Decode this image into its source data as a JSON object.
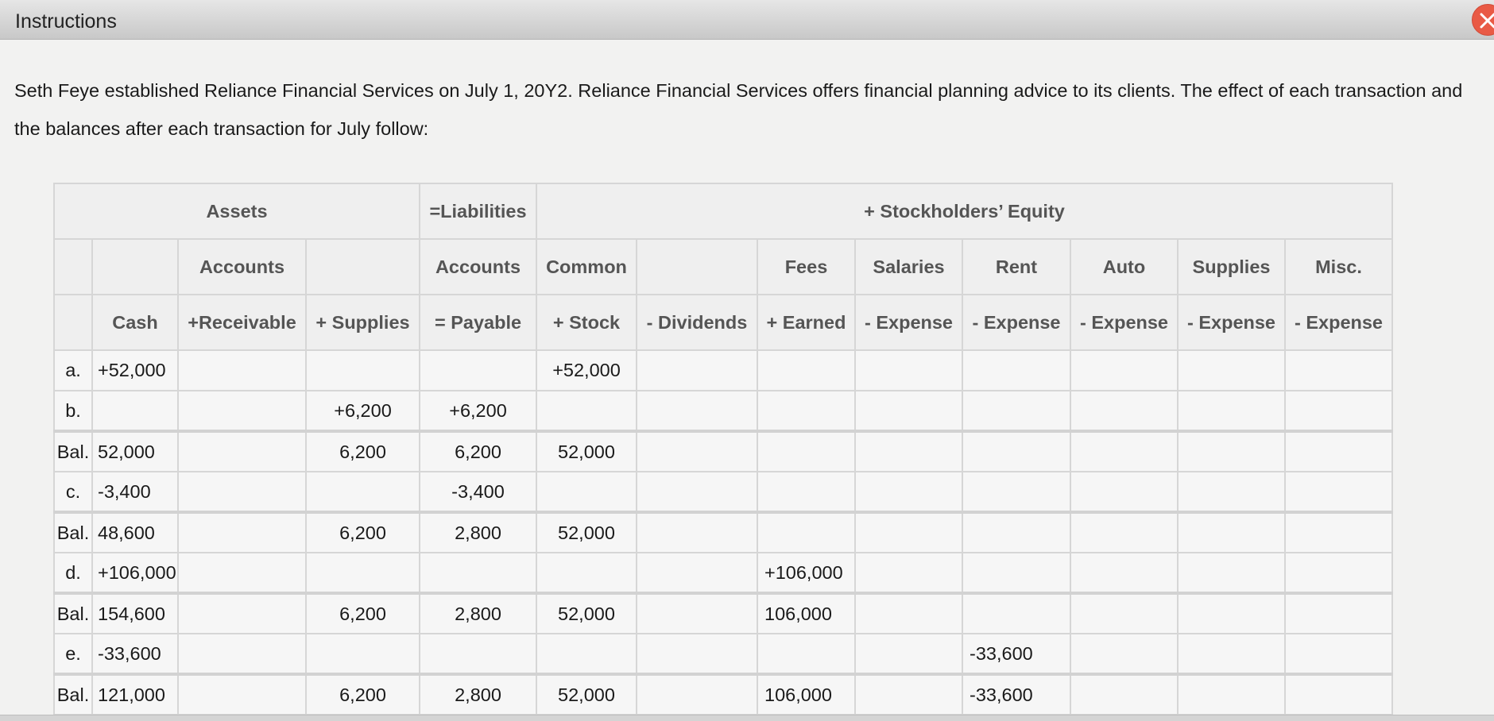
{
  "window": {
    "title": "Instructions",
    "close_label": "X"
  },
  "intro": {
    "line1": "Seth Feye established Reliance Financial Services on July 1, 20Y2. Reliance Financial Services offers financial planning advice to its clients. The effect of each transaction and",
    "line2": "the balances after each transaction for July follow:"
  },
  "table": {
    "group_headers": {
      "assets": "Assets",
      "liabilities": "=Liabilities",
      "equity": "+ Stockholders’ Equity"
    },
    "header_row1": [
      "",
      "",
      "Accounts",
      "",
      "Accounts",
      "Common",
      "",
      "Fees",
      "Salaries",
      "Rent",
      "Auto",
      "Supplies",
      "Misc."
    ],
    "header_row2": [
      "",
      "Cash",
      "+Receivable",
      "+ Supplies",
      "= Payable",
      "+ Stock",
      "- Dividends",
      "+ Earned",
      "- Expense",
      "- Expense",
      "- Expense",
      "- Expense",
      "- Expense"
    ],
    "rows": [
      {
        "label": "a.",
        "cells": [
          "+52,000",
          "",
          "",
          "",
          "+52,000",
          "",
          "",
          "",
          "",
          "",
          "",
          ""
        ],
        "balance": false
      },
      {
        "label": "b.",
        "cells": [
          "",
          "",
          "+6,200",
          "+6,200",
          "",
          "",
          "",
          "",
          "",
          "",
          "",
          ""
        ],
        "balance": false
      },
      {
        "label": "Bal.",
        "cells": [
          "52,000",
          "",
          "6,200",
          "6,200",
          "52,000",
          "",
          "",
          "",
          "",
          "",
          "",
          ""
        ],
        "balance": true
      },
      {
        "label": "c.",
        "cells": [
          "-3,400",
          "",
          "",
          "-3,400",
          "",
          "",
          "",
          "",
          "",
          "",
          "",
          ""
        ],
        "balance": false
      },
      {
        "label": "Bal.",
        "cells": [
          "48,600",
          "",
          "6,200",
          "2,800",
          "52,000",
          "",
          "",
          "",
          "",
          "",
          "",
          ""
        ],
        "balance": true
      },
      {
        "label": "d.",
        "cells": [
          "+106,000",
          "",
          "",
          "",
          "",
          "",
          "+106,000",
          "",
          "",
          "",
          "",
          ""
        ],
        "balance": false
      },
      {
        "label": "Bal.",
        "cells": [
          "154,600",
          "",
          "6,200",
          "2,800",
          "52,000",
          "",
          "106,000",
          "",
          "",
          "",
          "",
          ""
        ],
        "balance": true
      },
      {
        "label": "e.",
        "cells": [
          "-33,600",
          "",
          "",
          "",
          "",
          "",
          "",
          "",
          "-33,600",
          "",
          "",
          ""
        ],
        "balance": false
      },
      {
        "label": "Bal.",
        "cells": [
          "121,000",
          "",
          "6,200",
          "2,800",
          "52,000",
          "",
          "106,000",
          "",
          "-33,600",
          "",
          "",
          ""
        ],
        "balance": true
      }
    ]
  },
  "colors": {
    "close_button": "#e95a45",
    "header_text": "#555555",
    "grid": "#d6d6d6"
  }
}
